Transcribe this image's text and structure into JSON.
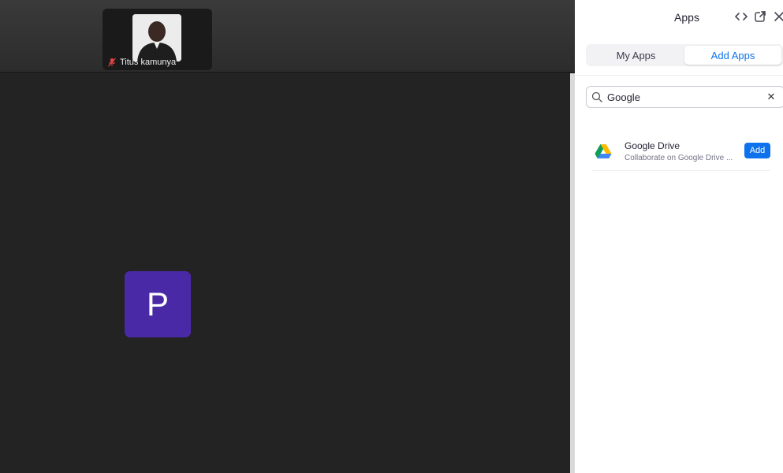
{
  "meeting": {
    "participant_thumbnail": {
      "name": "Titus kamunya",
      "muted": true
    },
    "active_tile": {
      "initial": "P",
      "color": "#4a29a6"
    }
  },
  "apps_panel": {
    "title": "Apps",
    "header_icons": [
      "code-icon",
      "popout-icon",
      "close-icon"
    ],
    "tabs": [
      {
        "label": "My Apps",
        "active": false
      },
      {
        "label": "Add Apps",
        "active": true
      }
    ],
    "search": {
      "value": "Google",
      "placeholder": ""
    },
    "results": [
      {
        "name": "Google Drive",
        "description": "Collaborate on Google Drive ...",
        "action_label": "Add"
      }
    ]
  },
  "colors": {
    "accent": "#0e72ed",
    "tile": "#4a29a6",
    "background": "#232323"
  }
}
